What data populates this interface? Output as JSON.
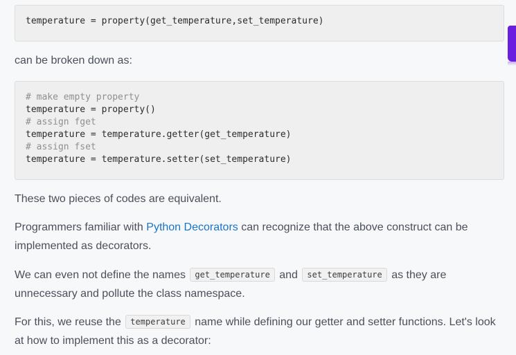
{
  "code_block_1": {
    "lines": [
      {
        "text": "temperature = property(get_temperature,set_temperature)",
        "comment": false
      }
    ]
  },
  "paragraph_1": "can be broken down as:",
  "code_block_2": {
    "lines": [
      {
        "text": "# make empty property",
        "comment": true
      },
      {
        "text": "temperature = property()",
        "comment": false
      },
      {
        "text": "# assign fget",
        "comment": true
      },
      {
        "text": "temperature = temperature.getter(get_temperature)",
        "comment": false
      },
      {
        "text": "# assign fset",
        "comment": true
      },
      {
        "text": "temperature = temperature.setter(set_temperature)",
        "comment": false
      }
    ]
  },
  "paragraph_2": "These two pieces of codes are equivalent.",
  "paragraph_3": {
    "before": "Programmers familiar with ",
    "link": "Python Decorators",
    "after": " can recognize that the above construct can be implemented as decorators."
  },
  "paragraph_4": {
    "before": "We can even not define the names ",
    "code1": "get_temperature",
    "middle": " and ",
    "code2": "set_temperature",
    "after": " as they are unnecessary and pollute the class namespace."
  },
  "paragraph_5": {
    "before": "For this, we reuse the ",
    "code": "temperature",
    "after": " name while defining our getter and setter functions. Let's look at how to implement this as a decorator:"
  },
  "colors": {
    "background": "#f7f8fa",
    "text": "#4a4f5a",
    "link": "#1a73c7",
    "code_bg": "#efefef",
    "comment": "#8f8f8f",
    "accent_tab": "#6a1ee0"
  }
}
